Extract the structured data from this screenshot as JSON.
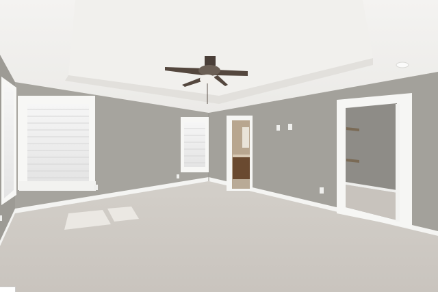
{
  "scene": {
    "description_visible_text": "",
    "colors": {
      "wall": "#a4a29c",
      "wall_dark": "#96948e",
      "ceiling": "#f3f2f0",
      "tray": "#e9e8e5",
      "trim": "#f7f7f5",
      "carpet": "#cdc8c2",
      "carpet_light": "#d8d4cf",
      "closet_wall": "#8f8d88",
      "bath_wall": "#b9a48a",
      "cabinet": "#6b4a2f",
      "fan": "#4a3f38"
    },
    "icons": [
      "ceiling-fan-icon",
      "window-blinds-icon",
      "outlet-icon",
      "light-switch-icon",
      "floor-vent-icon",
      "closet-shelf-icon"
    ]
  },
  "watermark": {
    "text": ""
  }
}
